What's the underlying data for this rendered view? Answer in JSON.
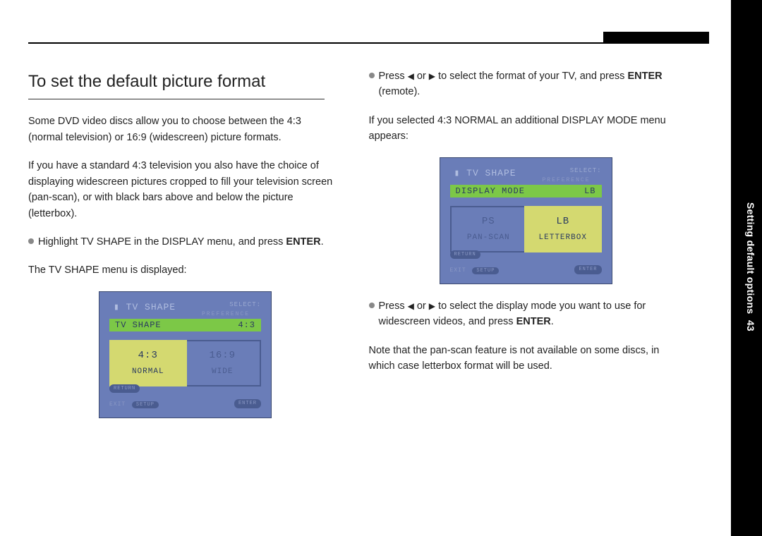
{
  "sidebar": {
    "label": "Setting default options",
    "page_number": "43"
  },
  "content": {
    "title": "To set the default picture format",
    "left": {
      "p1": "Some DVD video discs allow you to choose between the 4:3 (normal television) or 16:9 (widescreen) picture formats.",
      "p2": "If you have a standard 4:3 television you also have the choice of displaying widescreen pictures cropped to fill your television screen (pan-scan), or with black bars above and below the picture (letterbox).",
      "b1_pre": "Highlight TV SHAPE in the DISPLAY menu, and press ",
      "b1_strong": "ENTER",
      "b1_post": ".",
      "p3": "The TV SHAPE menu is displayed:"
    },
    "right": {
      "b1_pre": "Press ",
      "b1_mid": " or ",
      "b1_post": " to select the format of your TV, and press ",
      "b1_strong": "ENTER",
      "b1_tail": " (remote).",
      "p2": "If you selected 4:3 NORMAL an additional DISPLAY MODE menu appears:",
      "b3_pre": "Press ",
      "b3_mid": " or ",
      "b3_post": " to select the display mode you want to use for widescreen videos, and press ",
      "b3_strong": "ENTER",
      "b3_tail": ".",
      "p4": "Note that the pan-scan feature is not available on some discs, in which case letterbox format will be used."
    }
  },
  "screenshot1": {
    "title": "TV SHAPE",
    "select_hint": "SELECT:",
    "pref": "PREFERENCE",
    "bar_label": "TV SHAPE",
    "bar_value": "4:3",
    "opt_left_big": "4:3",
    "opt_left_small": "NORMAL",
    "opt_right_big": "16:9",
    "opt_right_small": "WIDE",
    "return": "RETURN",
    "exit": "EXIT",
    "setup": "SETUP",
    "enter": "ENTER"
  },
  "screenshot2": {
    "title": "TV SHAPE",
    "select_hint": "SELECT:",
    "pref": "PREFERENCE",
    "bar_label": "DISPLAY MODE",
    "bar_value": "LB",
    "opt_left_big": "PS",
    "opt_left_small": "PAN-SCAN",
    "opt_right_big": "LB",
    "opt_right_small": "LETTERBOX",
    "return": "RETURN",
    "exit": "EXIT",
    "setup": "SETUP",
    "enter": "ENTER"
  },
  "glyphs": {
    "left_arrow": "◀",
    "right_arrow": "▶"
  }
}
